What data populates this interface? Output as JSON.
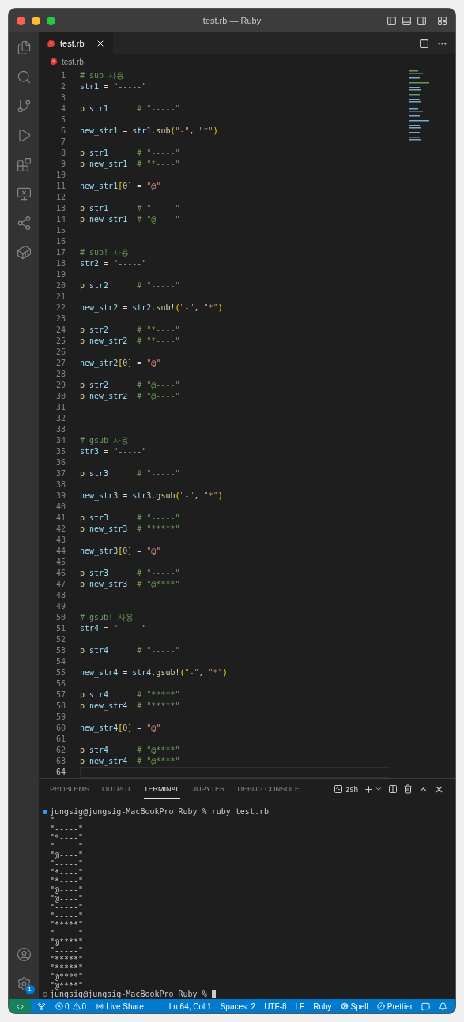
{
  "window": {
    "title": "test.rb — Ruby"
  },
  "tabs": [
    {
      "label": "test.rb",
      "selected": true
    }
  ],
  "breadcrumb": "test.rb",
  "editor": {
    "lines": [
      {
        "n": "1",
        "tokens": [
          {
            "kind": "comment",
            "text": "# sub 사용"
          }
        ]
      },
      {
        "n": "2",
        "tokens": [
          {
            "kind": "var",
            "text": "str1"
          },
          {
            "kind": "op",
            "text": " = "
          },
          {
            "kind": "str",
            "text": "\"-----\""
          }
        ]
      },
      {
        "n": "3"
      },
      {
        "n": "4",
        "tokens": [
          {
            "kind": "fn",
            "text": "p"
          },
          {
            "kind": "var",
            "text": " str1      "
          },
          {
            "kind": "comment",
            "text": "# \"-----\""
          }
        ]
      },
      {
        "n": "5"
      },
      {
        "n": "6",
        "tokens": [
          {
            "kind": "var",
            "text": "new_str1"
          },
          {
            "kind": "op",
            "text": " = "
          },
          {
            "kind": "var",
            "text": "str1"
          },
          {
            "kind": "op",
            "text": "."
          },
          {
            "kind": "fn",
            "text": "sub"
          },
          {
            "kind": "bracket",
            "text": "("
          },
          {
            "kind": "str",
            "text": "\"-\""
          },
          {
            "kind": "op",
            "text": ", "
          },
          {
            "kind": "str",
            "text": "\"*\""
          },
          {
            "kind": "bracket",
            "text": ")"
          }
        ]
      },
      {
        "n": "7"
      },
      {
        "n": "8",
        "tokens": [
          {
            "kind": "fn",
            "text": "p"
          },
          {
            "kind": "var",
            "text": " str1      "
          },
          {
            "kind": "comment",
            "text": "# \"-----\""
          }
        ]
      },
      {
        "n": "9",
        "tokens": [
          {
            "kind": "fn",
            "text": "p"
          },
          {
            "kind": "var",
            "text": " new_str1  "
          },
          {
            "kind": "comment",
            "text": "# \"*----\""
          }
        ]
      },
      {
        "n": "10"
      },
      {
        "n": "11",
        "tokens": [
          {
            "kind": "var",
            "text": "new_str1"
          },
          {
            "kind": "bracket",
            "text": "["
          },
          {
            "kind": "num",
            "text": "0"
          },
          {
            "kind": "bracket",
            "text": "]"
          },
          {
            "kind": "op",
            "text": " = "
          },
          {
            "kind": "str",
            "text": "\"@\""
          }
        ]
      },
      {
        "n": "12"
      },
      {
        "n": "13",
        "tokens": [
          {
            "kind": "fn",
            "text": "p"
          },
          {
            "kind": "var",
            "text": " str1      "
          },
          {
            "kind": "comment",
            "text": "# \"-----\""
          }
        ]
      },
      {
        "n": "14",
        "tokens": [
          {
            "kind": "fn",
            "text": "p"
          },
          {
            "kind": "var",
            "text": " new_str1  "
          },
          {
            "kind": "comment",
            "text": "# \"@----\""
          }
        ]
      },
      {
        "n": "15"
      },
      {
        "n": "16"
      },
      {
        "n": "17",
        "tokens": [
          {
            "kind": "comment",
            "text": "# sub! 사용"
          }
        ]
      },
      {
        "n": "18",
        "tokens": [
          {
            "kind": "var",
            "text": "str2"
          },
          {
            "kind": "op",
            "text": " = "
          },
          {
            "kind": "str",
            "text": "\"-----\""
          }
        ]
      },
      {
        "n": "19"
      },
      {
        "n": "20",
        "tokens": [
          {
            "kind": "fn",
            "text": "p"
          },
          {
            "kind": "var",
            "text": " str2      "
          },
          {
            "kind": "comment",
            "text": "# \"-----\""
          }
        ]
      },
      {
        "n": "21"
      },
      {
        "n": "22",
        "tokens": [
          {
            "kind": "var",
            "text": "new_str2"
          },
          {
            "kind": "op",
            "text": " = "
          },
          {
            "kind": "var",
            "text": "str2"
          },
          {
            "kind": "op",
            "text": "."
          },
          {
            "kind": "fn",
            "text": "sub!"
          },
          {
            "kind": "bracket",
            "text": "("
          },
          {
            "kind": "str",
            "text": "\"-\""
          },
          {
            "kind": "op",
            "text": ", "
          },
          {
            "kind": "str",
            "text": "\"*\""
          },
          {
            "kind": "bracket",
            "text": ")"
          }
        ]
      },
      {
        "n": "23"
      },
      {
        "n": "24",
        "tokens": [
          {
            "kind": "fn",
            "text": "p"
          },
          {
            "kind": "var",
            "text": " str2      "
          },
          {
            "kind": "comment",
            "text": "# \"*----\""
          }
        ]
      },
      {
        "n": "25",
        "tokens": [
          {
            "kind": "fn",
            "text": "p"
          },
          {
            "kind": "var",
            "text": " new_str2  "
          },
          {
            "kind": "comment",
            "text": "# \"*----\""
          }
        ]
      },
      {
        "n": "26"
      },
      {
        "n": "27",
        "tokens": [
          {
            "kind": "var",
            "text": "new_str2"
          },
          {
            "kind": "bracket",
            "text": "["
          },
          {
            "kind": "num",
            "text": "0"
          },
          {
            "kind": "bracket",
            "text": "]"
          },
          {
            "kind": "op",
            "text": " = "
          },
          {
            "kind": "str",
            "text": "\"@\""
          }
        ]
      },
      {
        "n": "28"
      },
      {
        "n": "29",
        "tokens": [
          {
            "kind": "fn",
            "text": "p"
          },
          {
            "kind": "var",
            "text": " str2      "
          },
          {
            "kind": "comment",
            "text": "# \"@----\""
          }
        ]
      },
      {
        "n": "30",
        "tokens": [
          {
            "kind": "fn",
            "text": "p"
          },
          {
            "kind": "var",
            "text": " new_str2  "
          },
          {
            "kind": "comment",
            "text": "# \"@----\""
          }
        ]
      },
      {
        "n": "31"
      },
      {
        "n": "32"
      },
      {
        "n": "33"
      },
      {
        "n": "34",
        "tokens": [
          {
            "kind": "comment",
            "text": "# gsub 사용"
          }
        ]
      },
      {
        "n": "35",
        "tokens": [
          {
            "kind": "var",
            "text": "str3"
          },
          {
            "kind": "op",
            "text": " = "
          },
          {
            "kind": "str",
            "text": "\"-----\""
          }
        ]
      },
      {
        "n": "36"
      },
      {
        "n": "37",
        "tokens": [
          {
            "kind": "fn",
            "text": "p"
          },
          {
            "kind": "var",
            "text": " str3      "
          },
          {
            "kind": "comment",
            "text": "# \"-----\""
          }
        ]
      },
      {
        "n": "38"
      },
      {
        "n": "39",
        "tokens": [
          {
            "kind": "var",
            "text": "new_str3"
          },
          {
            "kind": "op",
            "text": " = "
          },
          {
            "kind": "var",
            "text": "str3"
          },
          {
            "kind": "op",
            "text": "."
          },
          {
            "kind": "fn",
            "text": "gsub"
          },
          {
            "kind": "bracket",
            "text": "("
          },
          {
            "kind": "str",
            "text": "\"-\""
          },
          {
            "kind": "op",
            "text": ", "
          },
          {
            "kind": "str",
            "text": "\"*\""
          },
          {
            "kind": "bracket",
            "text": ")"
          }
        ]
      },
      {
        "n": "40"
      },
      {
        "n": "41",
        "tokens": [
          {
            "kind": "fn",
            "text": "p"
          },
          {
            "kind": "var",
            "text": " str3      "
          },
          {
            "kind": "comment",
            "text": "# \"-----\""
          }
        ]
      },
      {
        "n": "42",
        "tokens": [
          {
            "kind": "fn",
            "text": "p"
          },
          {
            "kind": "var",
            "text": " new_str3  "
          },
          {
            "kind": "comment",
            "text": "# \"*****\""
          }
        ]
      },
      {
        "n": "43"
      },
      {
        "n": "44",
        "tokens": [
          {
            "kind": "var",
            "text": "new_str3"
          },
          {
            "kind": "bracket",
            "text": "["
          },
          {
            "kind": "num",
            "text": "0"
          },
          {
            "kind": "bracket",
            "text": "]"
          },
          {
            "kind": "op",
            "text": " = "
          },
          {
            "kind": "str",
            "text": "\"@\""
          }
        ]
      },
      {
        "n": "45"
      },
      {
        "n": "46",
        "tokens": [
          {
            "kind": "fn",
            "text": "p"
          },
          {
            "kind": "var",
            "text": " str3      "
          },
          {
            "kind": "comment",
            "text": "# \"-----\""
          }
        ]
      },
      {
        "n": "47",
        "tokens": [
          {
            "kind": "fn",
            "text": "p"
          },
          {
            "kind": "var",
            "text": " new_str3  "
          },
          {
            "kind": "comment",
            "text": "# \"@****\""
          }
        ]
      },
      {
        "n": "48"
      },
      {
        "n": "49"
      },
      {
        "n": "50",
        "tokens": [
          {
            "kind": "comment",
            "text": "# gsub! 사용"
          }
        ]
      },
      {
        "n": "51",
        "tokens": [
          {
            "kind": "var",
            "text": "str4"
          },
          {
            "kind": "op",
            "text": " = "
          },
          {
            "kind": "str",
            "text": "\"-----\""
          }
        ]
      },
      {
        "n": "52"
      },
      {
        "n": "53",
        "tokens": [
          {
            "kind": "fn",
            "text": "p"
          },
          {
            "kind": "var",
            "text": " str4      "
          },
          {
            "kind": "comment",
            "text": "# \"-----\""
          }
        ]
      },
      {
        "n": "54"
      },
      {
        "n": "55",
        "tokens": [
          {
            "kind": "var",
            "text": "new_str4"
          },
          {
            "kind": "op",
            "text": " = "
          },
          {
            "kind": "var",
            "text": "str4"
          },
          {
            "kind": "op",
            "text": "."
          },
          {
            "kind": "fn",
            "text": "gsub!"
          },
          {
            "kind": "bracket",
            "text": "("
          },
          {
            "kind": "str",
            "text": "\"-\""
          },
          {
            "kind": "op",
            "text": ", "
          },
          {
            "kind": "str",
            "text": "\"*\""
          },
          {
            "kind": "bracket",
            "text": ")"
          }
        ]
      },
      {
        "n": "56"
      },
      {
        "n": "57",
        "tokens": [
          {
            "kind": "fn",
            "text": "p"
          },
          {
            "kind": "var",
            "text": " str4      "
          },
          {
            "kind": "comment",
            "text": "# \"*****\""
          }
        ]
      },
      {
        "n": "58",
        "tokens": [
          {
            "kind": "fn",
            "text": "p"
          },
          {
            "kind": "var",
            "text": " new_str4  "
          },
          {
            "kind": "comment",
            "text": "# \"*****\""
          }
        ]
      },
      {
        "n": "59"
      },
      {
        "n": "60",
        "tokens": [
          {
            "kind": "var",
            "text": "new_str4"
          },
          {
            "kind": "bracket",
            "text": "["
          },
          {
            "kind": "num",
            "text": "0"
          },
          {
            "kind": "bracket",
            "text": "]"
          },
          {
            "kind": "op",
            "text": " = "
          },
          {
            "kind": "str",
            "text": "\"@\""
          }
        ]
      },
      {
        "n": "61"
      },
      {
        "n": "62",
        "tokens": [
          {
            "kind": "fn",
            "text": "p"
          },
          {
            "kind": "var",
            "text": " str4      "
          },
          {
            "kind": "comment",
            "text": "# \"@****\""
          }
        ]
      },
      {
        "n": "63",
        "tokens": [
          {
            "kind": "fn",
            "text": "p"
          },
          {
            "kind": "var",
            "text": " new_str4  "
          },
          {
            "kind": "comment",
            "text": "# \"@****\""
          }
        ]
      },
      {
        "n": "64",
        "current": true
      }
    ]
  },
  "panel": {
    "tabs": [
      {
        "label": "PROBLEMS",
        "selected": false
      },
      {
        "label": "OUTPUT",
        "selected": false
      },
      {
        "label": "TERMINAL",
        "selected": true
      },
      {
        "label": "JUPYTER",
        "selected": false
      },
      {
        "label": "DEBUG CONSOLE",
        "selected": false
      }
    ],
    "shell": "zsh",
    "terminal": [
      {
        "kind": "prompt",
        "done": true,
        "text": "jungsig@jungsig-MacBookPro Ruby % ruby test.rb"
      },
      {
        "kind": "output",
        "text": "\"-----\""
      },
      {
        "kind": "output",
        "text": "\"-----\""
      },
      {
        "kind": "output",
        "text": "\"*----\""
      },
      {
        "kind": "output",
        "text": "\"-----\""
      },
      {
        "kind": "output",
        "text": "\"@----\""
      },
      {
        "kind": "output",
        "text": "\"-----\""
      },
      {
        "kind": "output",
        "text": "\"*----\""
      },
      {
        "kind": "output",
        "text": "\"*----\""
      },
      {
        "kind": "output",
        "text": "\"@----\""
      },
      {
        "kind": "output",
        "text": "\"@----\""
      },
      {
        "kind": "output",
        "text": "\"-----\""
      },
      {
        "kind": "output",
        "text": "\"-----\""
      },
      {
        "kind": "output",
        "text": "\"*****\""
      },
      {
        "kind": "output",
        "text": "\"-----\""
      },
      {
        "kind": "output",
        "text": "\"@****\""
      },
      {
        "kind": "output",
        "text": "\"-----\""
      },
      {
        "kind": "output",
        "text": "\"*****\""
      },
      {
        "kind": "output",
        "text": "\"*****\""
      },
      {
        "kind": "output",
        "text": "\"@****\""
      },
      {
        "kind": "output",
        "text": "\"@****\""
      },
      {
        "kind": "prompt",
        "done": false,
        "cursor": true,
        "text": "jungsig@jungsig-MacBookPro Ruby %"
      }
    ]
  },
  "activity_bar": {
    "settings_badge": "1"
  },
  "status_bar": {
    "errors": "0",
    "warnings": "0",
    "live_share": "Live Share",
    "position": "Ln 64, Col 1",
    "indent": "Spaces: 2",
    "encoding": "UTF-8",
    "eol": "LF",
    "language": "Ruby",
    "spell": "Spell",
    "prettier": "Prettier"
  }
}
